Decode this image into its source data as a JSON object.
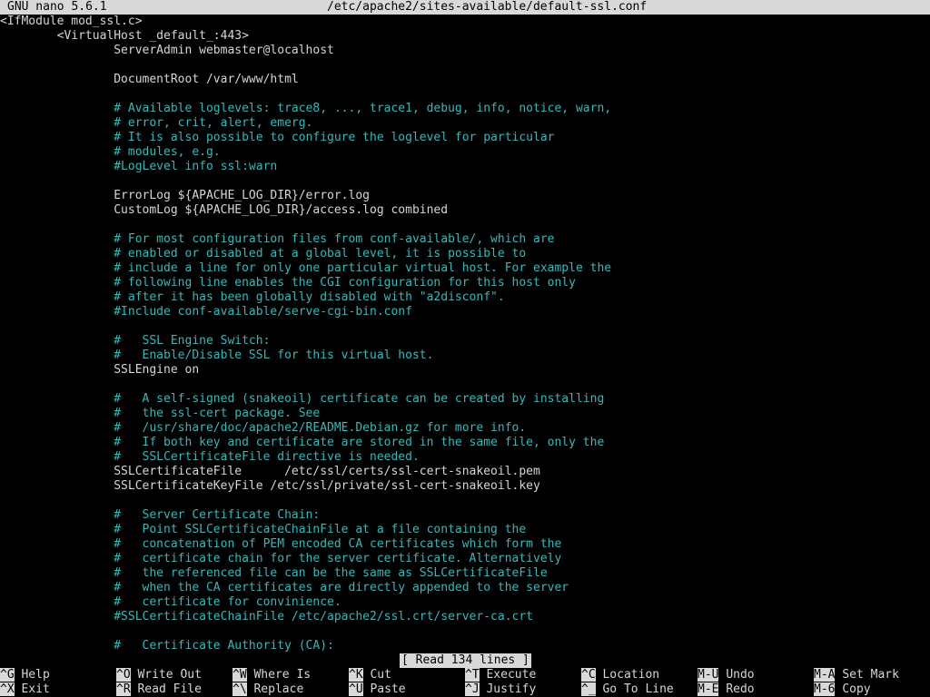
{
  "app_name": "GNU nano 5.6.1",
  "file_path": "/etc/apache2/sites-available/default-ssl.conf",
  "lines": [
    {
      "text": "<IfModule mod_ssl.c>",
      "type": "text"
    },
    {
      "text": "        <VirtualHost _default_:443>",
      "type": "text"
    },
    {
      "text": "                ServerAdmin webmaster@localhost",
      "type": "text"
    },
    {
      "text": "",
      "type": "text"
    },
    {
      "text": "                DocumentRoot /var/www/html",
      "type": "text"
    },
    {
      "text": "",
      "type": "text"
    },
    {
      "text": "                # Available loglevels: trace8, ..., trace1, debug, info, notice, warn,",
      "type": "comment"
    },
    {
      "text": "                # error, crit, alert, emerg.",
      "type": "comment"
    },
    {
      "text": "                # It is also possible to configure the loglevel for particular",
      "type": "comment"
    },
    {
      "text": "                # modules, e.g.",
      "type": "comment"
    },
    {
      "text": "                #LogLevel info ssl:warn",
      "type": "comment"
    },
    {
      "text": "",
      "type": "text"
    },
    {
      "text": "                ErrorLog ${APACHE_LOG_DIR}/error.log",
      "type": "text"
    },
    {
      "text": "                CustomLog ${APACHE_LOG_DIR}/access.log combined",
      "type": "text"
    },
    {
      "text": "",
      "type": "text"
    },
    {
      "text": "                # For most configuration files from conf-available/, which are",
      "type": "comment"
    },
    {
      "text": "                # enabled or disabled at a global level, it is possible to",
      "type": "comment"
    },
    {
      "text": "                # include a line for only one particular virtual host. For example the",
      "type": "comment"
    },
    {
      "text": "                # following line enables the CGI configuration for this host only",
      "type": "comment"
    },
    {
      "text": "                # after it has been globally disabled with \"a2disconf\".",
      "type": "comment"
    },
    {
      "text": "                #Include conf-available/serve-cgi-bin.conf",
      "type": "comment"
    },
    {
      "text": "",
      "type": "text"
    },
    {
      "text": "                #   SSL Engine Switch:",
      "type": "comment"
    },
    {
      "text": "                #   Enable/Disable SSL for this virtual host.",
      "type": "comment"
    },
    {
      "text": "                SSLEngine on",
      "type": "text"
    },
    {
      "text": "",
      "type": "text"
    },
    {
      "text": "                #   A self-signed (snakeoil) certificate can be created by installing",
      "type": "comment"
    },
    {
      "text": "                #   the ssl-cert package. See",
      "type": "comment"
    },
    {
      "text": "                #   /usr/share/doc/apache2/README.Debian.gz for more info.",
      "type": "comment"
    },
    {
      "text": "                #   If both key and certificate are stored in the same file, only the",
      "type": "comment"
    },
    {
      "text": "                #   SSLCertificateFile directive is needed.",
      "type": "comment"
    },
    {
      "text": "                SSLCertificateFile      /etc/ssl/certs/ssl-cert-snakeoil.pem",
      "type": "text"
    },
    {
      "text": "                SSLCertificateKeyFile /etc/ssl/private/ssl-cert-snakeoil.key",
      "type": "text"
    },
    {
      "text": "",
      "type": "text"
    },
    {
      "text": "                #   Server Certificate Chain:",
      "type": "comment"
    },
    {
      "text": "                #   Point SSLCertificateChainFile at a file containing the",
      "type": "comment"
    },
    {
      "text": "                #   concatenation of PEM encoded CA certificates which form the",
      "type": "comment"
    },
    {
      "text": "                #   certificate chain for the server certificate. Alternatively",
      "type": "comment"
    },
    {
      "text": "                #   the referenced file can be the same as SSLCertificateFile",
      "type": "comment"
    },
    {
      "text": "                #   when the CA certificates are directly appended to the server",
      "type": "comment"
    },
    {
      "text": "                #   certificate for convinience.",
      "type": "comment"
    },
    {
      "text": "                #SSLCertificateChainFile /etc/apache2/ssl.crt/server-ca.crt",
      "type": "comment"
    },
    {
      "text": "",
      "type": "text"
    },
    {
      "text": "                #   Certificate Authority (CA):",
      "type": "comment"
    }
  ],
  "status_message": "[ Read 134 lines ]",
  "shortcuts": [
    {
      "key": "^G",
      "label": "Help"
    },
    {
      "key": "^O",
      "label": "Write Out"
    },
    {
      "key": "^W",
      "label": "Where Is"
    },
    {
      "key": "^K",
      "label": "Cut"
    },
    {
      "key": "^T",
      "label": "Execute"
    },
    {
      "key": "^C",
      "label": "Location"
    },
    {
      "key": "M-U",
      "label": "Undo"
    },
    {
      "key": "M-A",
      "label": "Set Mark"
    },
    {
      "key": "^X",
      "label": "Exit"
    },
    {
      "key": "^R",
      "label": "Read File"
    },
    {
      "key": "^\\",
      "label": "Replace"
    },
    {
      "key": "^U",
      "label": "Paste"
    },
    {
      "key": "^J",
      "label": "Justify"
    },
    {
      "key": "^_",
      "label": "Go To Line"
    },
    {
      "key": "M-E",
      "label": "Redo"
    },
    {
      "key": "M-6",
      "label": "Copy"
    }
  ],
  "colors": {
    "background": "#000000",
    "text": "#d6d6d6",
    "comment": "#3ab7b7",
    "bar": "#d9d9d9"
  }
}
